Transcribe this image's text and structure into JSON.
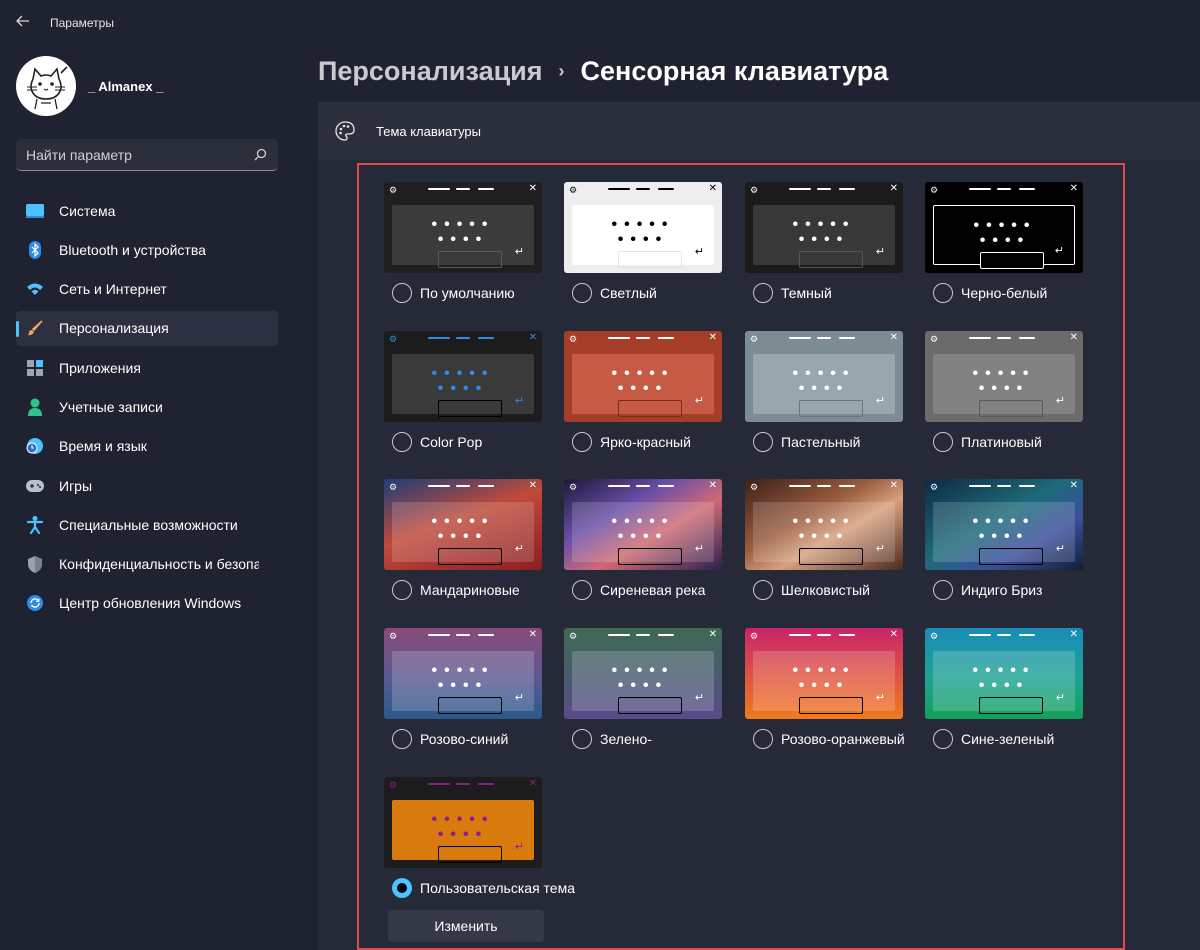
{
  "app": {
    "title": "Параметры",
    "back_icon": "back-arrow-icon"
  },
  "profile": {
    "user_name": "_ Almanex _",
    "avatar_icon": "cat-avatar"
  },
  "search": {
    "placeholder": "Найти параметр",
    "icon": "search-icon"
  },
  "nav": [
    {
      "label": "Система",
      "icon": "monitor-icon",
      "color": "#4cc2ff"
    },
    {
      "label": "Bluetooth и устройства",
      "icon": "bluetooth-icon",
      "color": "#2f8ae8"
    },
    {
      "label": "Сеть и Интернет",
      "icon": "wifi-icon",
      "color": "#4cc2ff"
    },
    {
      "label": "Персонализация",
      "icon": "brush-icon",
      "color": "#f0a65e",
      "active": true
    },
    {
      "label": "Приложения",
      "icon": "apps-icon",
      "color": "#9aa4b8"
    },
    {
      "label": "Учетные записи",
      "icon": "person-icon",
      "color": "#2ec48a"
    },
    {
      "label": "Время и язык",
      "icon": "globe-clock-icon",
      "color": "#4cc2ff"
    },
    {
      "label": "Игры",
      "icon": "gamepad-icon",
      "color": "#b9bfcc"
    },
    {
      "label": "Специальные возможности",
      "icon": "accessibility-icon",
      "color": "#4cc2ff"
    },
    {
      "label": "Конфиденциальность и безопасность",
      "icon": "shield-icon",
      "color": "#9aa0ad"
    },
    {
      "label": "Центр обновления Windows",
      "icon": "update-icon",
      "color": "#2f8ae8"
    }
  ],
  "breadcrumb": {
    "parent": "Персонализация",
    "separator": "›",
    "current": "Сенсорная клавиатура"
  },
  "panel": {
    "title": "Тема клавиатуры",
    "icon": "palette-icon"
  },
  "themes": [
    {
      "label": "По умолчанию",
      "bg": "#1f1f1f",
      "body": "#3b3b3b",
      "dots": "#ffffff",
      "space": "#5a5a5a",
      "accent": "#ffffff",
      "selected": false
    },
    {
      "label": "Светлый",
      "bg": "#eeeeee",
      "body": "#ffffff",
      "dots": "#000000",
      "space": "#e5e5e5",
      "accent": "#000000",
      "selected": false
    },
    {
      "label": "Темный",
      "bg": "#1b1b1b",
      "body": "#383838",
      "dots": "#ffffff",
      "space": "#555555",
      "accent": "#ffffff",
      "selected": false
    },
    {
      "label": "Черно-белый",
      "bg": "#000000",
      "body": "#000000",
      "dots": "#ffffff",
      "space": "#ffffff",
      "accent": "#ffffff",
      "selected": false,
      "outlined": true
    },
    {
      "label": "Color Pop",
      "bg": "#1c1c1c",
      "body": "#3a3a3a",
      "dots": "#2f8ae8",
      "space": "#000000",
      "accent": "#2f8ae8",
      "selected": false
    },
    {
      "label": "Ярко-красный",
      "bg": "#a53d28",
      "body": "#c65a45",
      "dots": "#ffffff",
      "space": "#7a2d1e",
      "accent": "#ffffff",
      "selected": false
    },
    {
      "label": "Пастельный",
      "bg": "#7d8b92",
      "body": "#98a6ad",
      "dots": "#ffffff",
      "space": "#6a767c",
      "accent": "#ffffff",
      "selected": false
    },
    {
      "label": "Платиновый",
      "bg": "#6b6b6b",
      "body": "#828282",
      "dots": "#ffffff",
      "space": "#5a5a5a",
      "accent": "#ffffff",
      "selected": false
    },
    {
      "label": "Мандариновые",
      "bg": "linear-gradient(160deg,#203e78 0%,#c04a3a 45%,#8a1e24 100%)",
      "body": "rgba(255,255,255,0.16)",
      "dots": "#ffffff",
      "space": "#000000",
      "accent": "#ffffff",
      "selected": false
    },
    {
      "label": "Сиреневая река",
      "bg": "linear-gradient(150deg,#1c1a3a 0%,#6a4ea8 35%,#d06a74 60%,#2a2050 100%)",
      "body": "rgba(255,255,255,0.16)",
      "dots": "#ffffff",
      "space": "#000000",
      "accent": "#ffffff",
      "selected": false
    },
    {
      "label": "Шелковистый",
      "bg": "linear-gradient(150deg,#3b2018 0%,#9a5c3e 40%,#d7a07e 60%,#4a2a20 100%)",
      "body": "rgba(255,255,255,0.16)",
      "dots": "#ffffff",
      "space": "#000000",
      "accent": "#ffffff",
      "selected": false
    },
    {
      "label": "Индиго Бриз",
      "bg": "linear-gradient(150deg,#0e2a44 0%,#1d6a7a 45%,#3a4f9c 70%,#102038 100%)",
      "body": "rgba(255,255,255,0.16)",
      "dots": "#ffffff",
      "space": "#000000",
      "accent": "#ffffff",
      "selected": false
    },
    {
      "label": "Розово-синий",
      "bg": "linear-gradient(180deg,#8a4a7a 0%,#5a5a92 55%,#2a5a8a 100%)",
      "body": "rgba(255,255,255,0.18)",
      "dots": "#ffffff",
      "space": "#000000",
      "accent": "#ffffff",
      "selected": false
    },
    {
      "label": "Зелено-",
      "bg": "linear-gradient(180deg,#3e6a52 0%,#4a5a72 55%,#5a4a8a 100%)",
      "body": "rgba(255,255,255,0.18)",
      "dots": "#ffffff",
      "space": "#000000",
      "accent": "#ffffff",
      "selected": false
    },
    {
      "label": "Розово-оранжевый",
      "bg": "linear-gradient(180deg,#c8246a 0%,#e0553e 55%,#f07a1e 100%)",
      "body": "rgba(255,255,255,0.18)",
      "dots": "#ffffff",
      "space": "#000000",
      "accent": "#ffffff",
      "selected": false
    },
    {
      "label": "Сине-зеленый",
      "bg": "linear-gradient(180deg,#1a8cb8 0%,#1ea294 55%,#14a05a 100%)",
      "body": "rgba(255,255,255,0.18)",
      "dots": "#ffffff",
      "space": "#000000",
      "accent": "#ffffff",
      "selected": false
    },
    {
      "label": "Пользовательская тема",
      "bg": "#1c1c1c",
      "body": "#d97a0e",
      "dots": "#8a1e8a",
      "space": "#000000",
      "accent": "#8a1e8a",
      "selected": true
    }
  ],
  "change_button": "Изменить"
}
